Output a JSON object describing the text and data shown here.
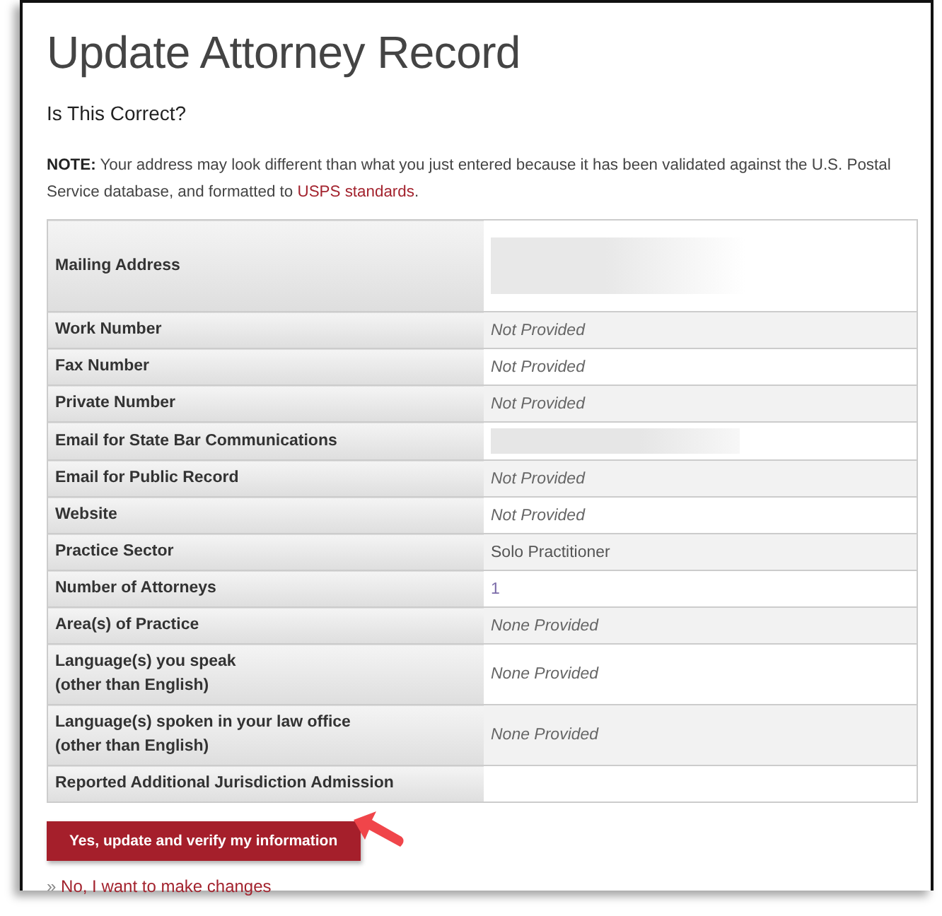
{
  "title": "Update Attorney Record",
  "subtitle": "Is This Correct?",
  "note": {
    "text": "**NOTE:** Your address may look different than what you just entered because it has been validated against the U.S. Postal Service database, and formatted to",
    "link": "USPS standards",
    "tail": "."
  },
  "table": {
    "rows": [
      {
        "label": "Mailing Address",
        "kind": "redacted_block"
      },
      {
        "label": "Work Number",
        "kind": "italic",
        "value": "Not Provided"
      },
      {
        "label": "Fax Number",
        "kind": "italic",
        "value": "Not Provided"
      },
      {
        "label": "Private Number",
        "kind": "italic",
        "value": "Not Provided"
      },
      {
        "label": "Email for State Bar Communications",
        "kind": "redacted_line"
      },
      {
        "label": "Email for Public Record",
        "kind": "italic",
        "value": "Not Provided"
      },
      {
        "label": "Website",
        "kind": "italic",
        "value": "Not Provided"
      },
      {
        "label": "Practice Sector",
        "kind": "plain",
        "value": "Solo Practitioner"
      },
      {
        "label": "Number of Attorneys",
        "kind": "link",
        "value": "1"
      },
      {
        "label": "Area(s) of Practice",
        "kind": "italic",
        "value": "None Provided"
      },
      {
        "label": "Language(s) you speak\n(other than English)",
        "kind": "italic",
        "value": "None Provided"
      },
      {
        "label": "Language(s) spoken in your law office\n(other than English)",
        "kind": "italic",
        "value": "None Provided"
      },
      {
        "label": "Reported Additional Jurisdiction Admission",
        "kind": "empty"
      }
    ]
  },
  "confirm_button": "Yes, update and verify my information",
  "change_link": {
    "marker": "»",
    "text": "No, I want to make changes"
  }
}
